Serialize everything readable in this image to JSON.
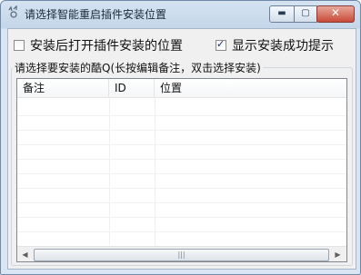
{
  "window": {
    "title": "请选择智能重启插件安装位置",
    "controls": {
      "minimize": "▬",
      "maximize": "▢",
      "close": "✕"
    }
  },
  "options": {
    "open_location": {
      "label": "安装后打开插件安装的位置",
      "checked": false
    },
    "show_success": {
      "label": "显示安装成功提示",
      "checked": true
    }
  },
  "group": {
    "label": "请选择要安装的酷Q(长按编辑备注，双击选择安装)"
  },
  "table": {
    "columns": [
      "备注",
      "ID",
      "位置"
    ],
    "rows": []
  },
  "scrollbar": {
    "left_arrow": "◀",
    "right_arrow": "▶",
    "grip": "|||"
  },
  "icons": [
    "app-icon",
    "checkbox-icon",
    "minimize-icon",
    "maximize-icon",
    "close-icon"
  ]
}
